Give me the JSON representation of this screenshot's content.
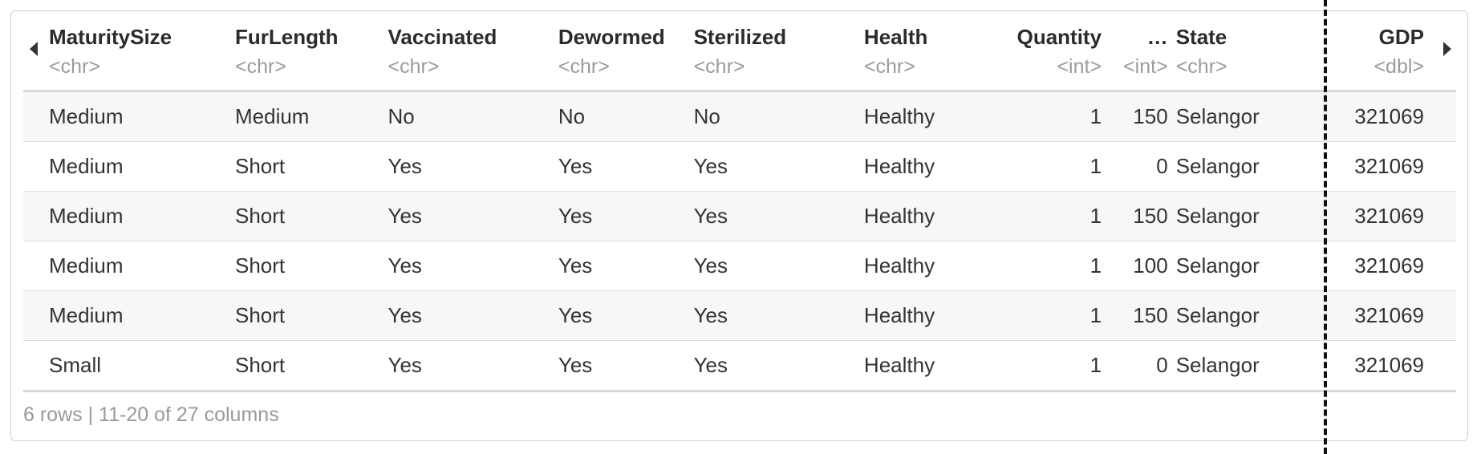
{
  "table": {
    "columns": [
      {
        "name": "MaturitySize",
        "type": "<chr>"
      },
      {
        "name": "FurLength",
        "type": "<chr>"
      },
      {
        "name": "Vaccinated",
        "type": "<chr>"
      },
      {
        "name": "Dewormed",
        "type": "<chr>"
      },
      {
        "name": "Sterilized",
        "type": "<chr>"
      },
      {
        "name": "Health",
        "type": "<chr>"
      },
      {
        "name": "Quantity",
        "type": "<int>"
      },
      {
        "name": "…",
        "type": "<int>"
      },
      {
        "name": "State",
        "type": "<chr>"
      },
      {
        "name": "GDP",
        "type": "<dbl>"
      }
    ],
    "rows": [
      [
        "Medium",
        "Medium",
        "No",
        "No",
        "No",
        "Healthy",
        "1",
        "150",
        "Selangor",
        "321069"
      ],
      [
        "Medium",
        "Short",
        "Yes",
        "Yes",
        "Yes",
        "Healthy",
        "1",
        "0",
        "Selangor",
        "321069"
      ],
      [
        "Medium",
        "Short",
        "Yes",
        "Yes",
        "Yes",
        "Healthy",
        "1",
        "150",
        "Selangor",
        "321069"
      ],
      [
        "Medium",
        "Short",
        "Yes",
        "Yes",
        "Yes",
        "Healthy",
        "1",
        "100",
        "Selangor",
        "321069"
      ],
      [
        "Medium",
        "Short",
        "Yes",
        "Yes",
        "Yes",
        "Healthy",
        "1",
        "150",
        "Selangor",
        "321069"
      ],
      [
        "Small",
        "Short",
        "Yes",
        "Yes",
        "Yes",
        "Healthy",
        "1",
        "0",
        "Selangor",
        "321069"
      ]
    ]
  },
  "footer": {
    "summary": "6 rows | 11-20 of 27 columns"
  },
  "icons": {
    "prev": "caret-left-icon",
    "next": "caret-right-icon"
  }
}
